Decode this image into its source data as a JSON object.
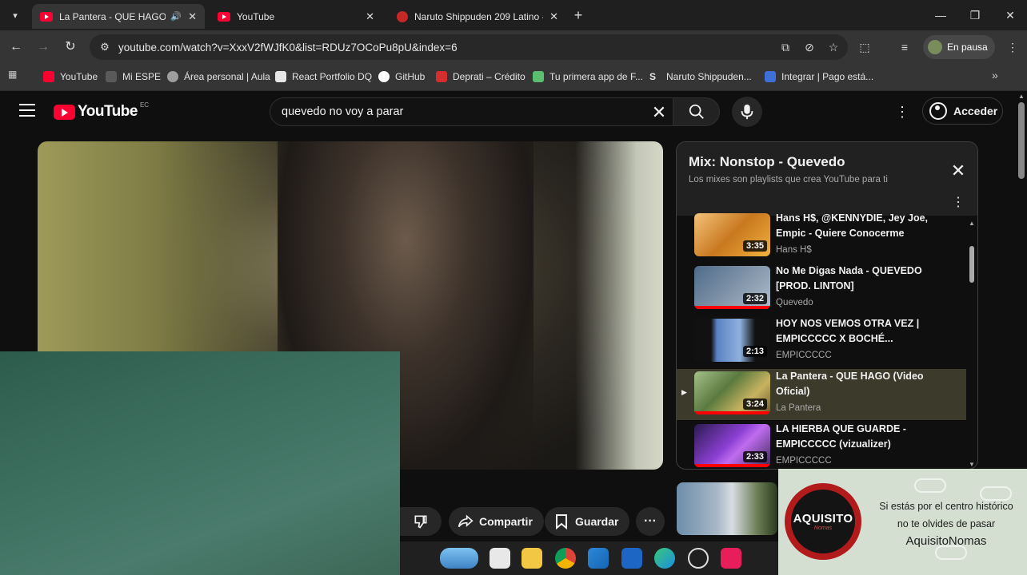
{
  "browser": {
    "tabs": [
      {
        "title": "La Pantera - QUE HAGO (Vi",
        "icon": "youtube-icon",
        "active": true,
        "audio": true
      },
      {
        "title": "YouTube",
        "icon": "youtube-icon",
        "active": false
      },
      {
        "title": "Naruto Shippuden 209 Latino -",
        "icon": "naruto-site-icon",
        "active": false
      }
    ],
    "url": "youtube.com/watch?v=XxxV2fWJfK0&list=RDUz7OCoPu8pU&index=6",
    "profile_status": "En pausa",
    "bookmarks": [
      {
        "label": "YouTube",
        "color": "#ff0033"
      },
      {
        "label": "Mi ESPE",
        "color": "#5a5a5a"
      },
      {
        "label": "Área personal | Aula",
        "color": "#9e9e9e"
      },
      {
        "label": "React Portfolio DQ",
        "color": "#e6e6e6"
      },
      {
        "label": "GitHub",
        "color": "#ffffff"
      },
      {
        "label": "Deprati – Crédito",
        "color": "#d32f2f"
      },
      {
        "label": "Tu primera app de F...",
        "color": "#5bbd6f"
      },
      {
        "label": "Naruto Shippuden...",
        "color": "#e6e6e6"
      },
      {
        "label": "Integrar | Pago está...",
        "color": "#3f6fd8"
      }
    ]
  },
  "youtube": {
    "logo_text": "YouTube",
    "country": "EC",
    "search_query": "quevedo no voy a parar",
    "signin_label": "Acceder",
    "actions": {
      "share": "Compartir",
      "save": "Guardar"
    },
    "playlist": {
      "title": "Mix: Nonstop - Quevedo",
      "subtitle": "Los mixes son playlists que crea YouTube para ti",
      "items": [
        {
          "title": "Hans H$, @KENNYDIE, Jey Joe, Empic - Quiere Conocerme",
          "channel": "Hans H$",
          "duration": "3:35",
          "current": false
        },
        {
          "title": "No Me Digas Nada - QUEVEDO [PROD. LINTON]",
          "channel": "Quevedo",
          "duration": "2:32",
          "current": false
        },
        {
          "title": "HOY NOS VEMOS OTRA VEZ | EMPICCCCC X BOCHÉ...",
          "channel": "EMPICCCCC",
          "duration": "2:13",
          "current": false
        },
        {
          "title": "La Pantera - QUE HAGO (Video Oficial)",
          "channel": "La Pantera",
          "duration": "3:24",
          "current": true
        },
        {
          "title": "LA HIERBA QUE GUARDE - EMPICCCCC (vizualizer)",
          "channel": "EMPICCCCC",
          "duration": "2:33",
          "current": false
        }
      ]
    }
  },
  "ad": {
    "logo_name": "AQUISITO",
    "logo_tag": "Nomas",
    "line1": "Si estás por el centro histórico",
    "line2": "no te olvides de pasar",
    "line3": "AquisitoNomas"
  },
  "taskbar": {
    "apps": [
      "weather-widget-icon",
      "file-viewer-icon",
      "file-explorer-icon",
      "chrome-icon",
      "store-icon",
      "outlook-icon",
      "edge-icon",
      "game-icon",
      "tiktok-icon"
    ]
  },
  "colors": {
    "youtube_red": "#ff0033",
    "background": "#0f0f0f",
    "now_playing_row": "#3b3a2b"
  }
}
